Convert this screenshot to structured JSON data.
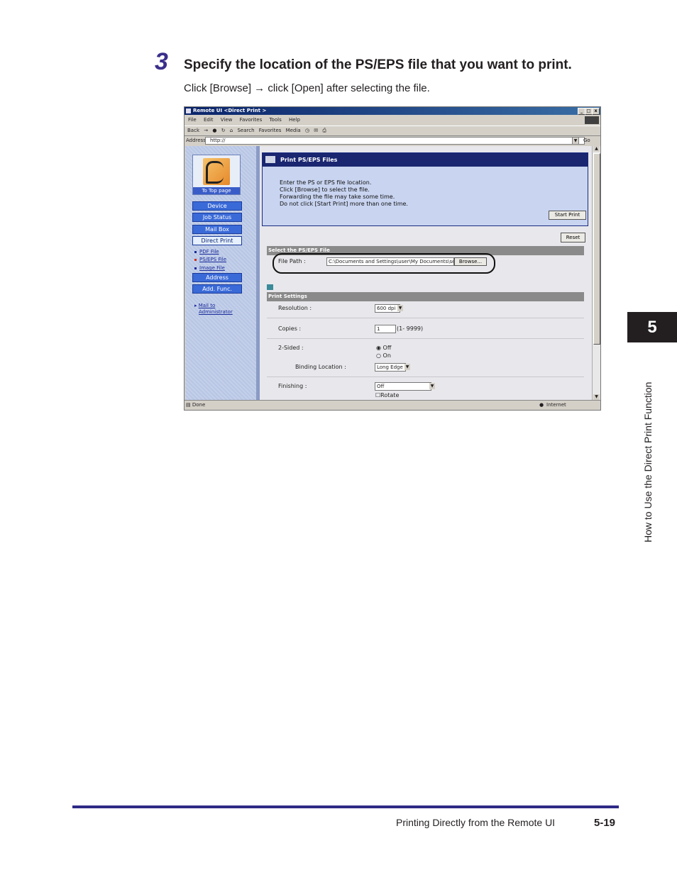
{
  "step": {
    "number": "3",
    "title": "Specify the location of the PS/EPS file that you want to print.",
    "instruction": "Click [Browse] → click [Open] after selecting the file."
  },
  "browser": {
    "window_title": "Remote UI <Direct Print >",
    "menu": [
      "File",
      "Edit",
      "View",
      "Favorites",
      "Tools",
      "Help"
    ],
    "toolbar": [
      "Back",
      "→",
      "Search",
      "Favorites",
      "Media"
    ],
    "address_label": "Address",
    "address_value": "http://",
    "go_label": "Go",
    "status_text": "Done",
    "status_zone": "Internet"
  },
  "nav": {
    "top_page": "To Top page",
    "buttons": [
      "Device",
      "Job Status",
      "Mail Box",
      "Direct Print"
    ],
    "sublinks": [
      "PDF File",
      "PS/EPS File",
      "Image File"
    ],
    "buttons2": [
      "Address",
      "Add. Func."
    ],
    "mail_line1": "Mail to",
    "mail_line2": "Administrator"
  },
  "panel": {
    "heading": "Print PS/EPS Files",
    "lines": [
      "Enter the PS or EPS file location.",
      "Click [Browse] to select the file.",
      "Forwarding the file may take some time.",
      "Do not click [Start Print] more than one time."
    ],
    "start_print": "Start Print"
  },
  "form": {
    "reset": "Reset",
    "select_section": "Select the PS/EPS File",
    "file_path_label": "File Path :",
    "file_path_value": "C:\\Documents and Settings\\user\\My Documents\\sei",
    "browse": "Browse...",
    "print_settings": "Print Settings",
    "resolution_label": "Resolution :",
    "resolution_value": "600 dpi",
    "copies_label": "Copies :",
    "copies_value": "1",
    "copies_range": "(1- 9999)",
    "two_sided_label": "2-Sided :",
    "opt_off": "Off",
    "opt_on": "On",
    "binding_label": "Binding Location :",
    "binding_value": "Long Edge",
    "finishing_label": "Finishing :",
    "finishing_value": "Off",
    "rotate_label": "Rotate"
  },
  "sidebar_tab": {
    "chapter": "5",
    "section": "How to Use the Direct Print Function"
  },
  "footer": {
    "title": "Printing Directly from the Remote UI",
    "page": "5-19"
  }
}
